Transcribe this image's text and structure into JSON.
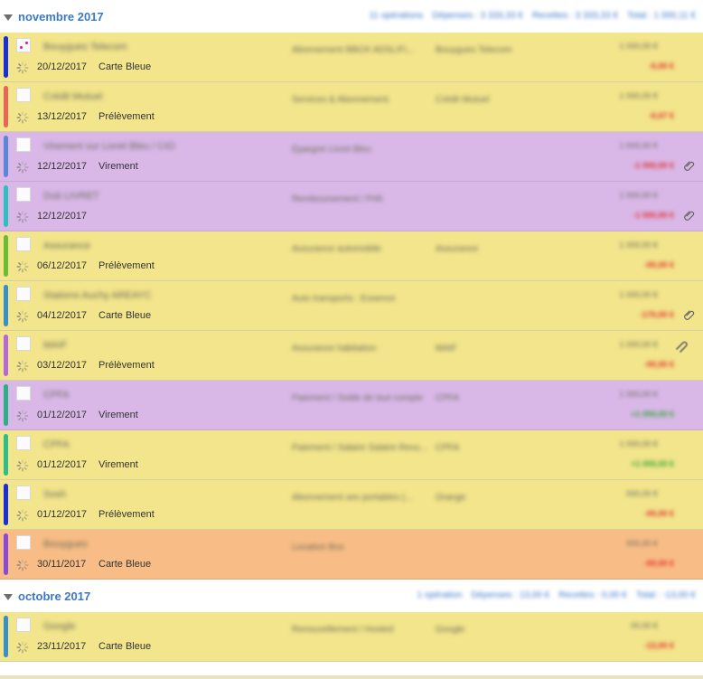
{
  "groups": [
    {
      "month": "novembre 2017",
      "summary": [
        "11 opérations",
        "Dépenses : 3 333,33 €",
        "Recettes : 3 333,33 €",
        "Total : 1 000,11 €"
      ],
      "rows": [
        {
          "strip": "#1a2fd6",
          "bg": "yellow",
          "icon_marked": true,
          "title": "Bouygues Telecom",
          "date": "20/12/2017",
          "type": "Carte Bleue",
          "desc": "Abonnement BBOX ADSL/Fi...",
          "payee": "Bouygues Telecom",
          "balance": "1 000,00 €",
          "amount": "-0,00 €",
          "sign": "neg",
          "clip": false,
          "attach": false
        },
        {
          "strip": "#e8655a",
          "bg": "yellow",
          "icon_marked": false,
          "title": "Crédit Mutuel",
          "date": "13/12/2017",
          "type": "Prélèvement",
          "desc": "Services & Abonnement",
          "payee": "Crédit Mutuel",
          "balance": "1 000,00 €",
          "amount": "-0,07 €",
          "sign": "neg",
          "clip": false,
          "attach": false
        },
        {
          "strip": "#5c86d6",
          "bg": "purple",
          "icon_marked": false,
          "title": "Virement sur Livret Bleu / CIO",
          "date": "12/12/2017",
          "type": "Virement",
          "desc": "Épargne Livret Bleu",
          "payee": "",
          "balance": "1 000,00 €",
          "amount": "-1 000,00 €",
          "sign": "neg",
          "clip": true,
          "attach": false
        },
        {
          "strip": "#2fbfc0",
          "bg": "purple",
          "icon_marked": false,
          "title": "Dub LIVRET",
          "date": "12/12/2017",
          "type": "",
          "desc": "Remboursement / Prêt",
          "payee": "",
          "balance": "1 000,00 €",
          "amount": "-1 000,00 €",
          "sign": "neg",
          "clip": true,
          "attach": false
        },
        {
          "strip": "#6cbc3a",
          "bg": "yellow",
          "icon_marked": false,
          "title": "Assurance",
          "date": "06/12/2017",
          "type": "Prélèvement",
          "desc": "Assurance automobile",
          "payee": "Assurance",
          "balance": "1 000,00 €",
          "amount": "-00,00 €",
          "sign": "neg",
          "clip": false,
          "attach": false
        },
        {
          "strip": "#3a8fc4",
          "bg": "yellow",
          "icon_marked": false,
          "title": "Stations Auchy AREAYC",
          "date": "04/12/2017",
          "type": "Carte Bleue",
          "desc": "Auto transports : Essence",
          "payee": "",
          "balance": "1 000,00 €",
          "amount": "-170,00 €",
          "sign": "neg",
          "clip": true,
          "attach": false
        },
        {
          "strip": "#b46ad6",
          "bg": "yellow",
          "icon_marked": false,
          "title": "MAIF",
          "date": "03/12/2017",
          "type": "Prélèvement",
          "desc": "Assurance habitation",
          "payee": "MAIF",
          "balance": "1 000,00 €",
          "amount": "-00,00 €",
          "sign": "neg",
          "clip": false,
          "attach": true
        },
        {
          "strip": "#2fae8a",
          "bg": "purple",
          "icon_marked": false,
          "title": "CPFA",
          "date": "01/12/2017",
          "type": "Virement",
          "desc": "Paiement / Solde de tout compte",
          "payee": "CPFA",
          "balance": "1 000,00 €",
          "amount": "+1 000,00 €",
          "sign": "pos",
          "clip": false,
          "attach": false
        },
        {
          "strip": "#2fbe8a",
          "bg": "yellow",
          "icon_marked": false,
          "title": "CPFA",
          "date": "01/12/2017",
          "type": "Virement",
          "desc": "Paiement / Salaire Salaire Revu...",
          "payee": "CPFA",
          "balance": "1 000,00 €",
          "amount": "+1 000,00 €",
          "sign": "pos",
          "clip": false,
          "attach": false
        },
        {
          "strip": "#1a2fd6",
          "bg": "yellow",
          "icon_marked": false,
          "title": "Sosh",
          "date": "01/12/2017",
          "type": "Prélèvement",
          "desc": "Abonnement ses portables (...",
          "payee": "Orange",
          "balance": "000,00 €",
          "amount": "-00,00 €",
          "sign": "neg",
          "clip": false,
          "attach": false
        },
        {
          "strip": "#8a4ad6",
          "bg": "orange",
          "icon_marked": false,
          "title": "Bouygues",
          "date": "30/11/2017",
          "type": "Carte Bleue",
          "desc": "Location Box",
          "payee": "",
          "balance": "000,00 €",
          "amount": "-00,00 €",
          "sign": "neg",
          "clip": false,
          "attach": false
        }
      ]
    },
    {
      "month": "octobre 2017",
      "summary": [
        "1 opération",
        "Dépenses : 13,00 €",
        "Recettes : 0,00 €",
        "Total : -13,00 €"
      ],
      "rows": [
        {
          "strip": "#3a8fc4",
          "bg": "yellow",
          "icon_marked": false,
          "title": "Google",
          "date": "23/11/2017",
          "type": "Carte Bleue",
          "desc": "Renouvellement / Hosted",
          "payee": "Google",
          "balance": "00,00 €",
          "amount": "-13,00 €",
          "sign": "neg",
          "clip": false,
          "attach": false
        }
      ]
    }
  ]
}
